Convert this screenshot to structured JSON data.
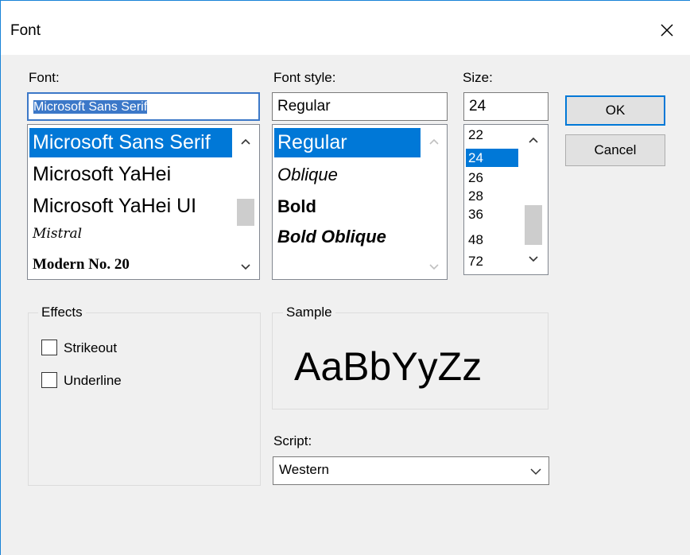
{
  "window": {
    "title": "Font"
  },
  "font": {
    "label": "Font:",
    "value": "Microsoft Sans Serif",
    "items": [
      "Microsoft Sans Serif",
      "Microsoft YaHei",
      "Microsoft YaHei UI",
      "Mistral",
      "Modern No. 20"
    ],
    "selected_index": 0
  },
  "style": {
    "label": "Font style:",
    "value": "Regular",
    "items": [
      "Regular",
      "Oblique",
      "Bold",
      "Bold Oblique"
    ],
    "selected_index": 0
  },
  "size": {
    "label": "Size:",
    "value": "24",
    "items": [
      "22",
      "24",
      "26",
      "28",
      "36",
      "48",
      "72"
    ],
    "selected_index": 1
  },
  "buttons": {
    "ok": "OK",
    "cancel": "Cancel"
  },
  "effects": {
    "label": "Effects",
    "strikeout": {
      "label": "Strikeout",
      "checked": false
    },
    "underline": {
      "label": "Underline",
      "checked": false
    }
  },
  "sample": {
    "label": "Sample",
    "text": "AaBbYyZz"
  },
  "script": {
    "label": "Script:",
    "value": "Western"
  },
  "icons": {
    "close": "close-icon",
    "scroll_up": "chevron-up-icon",
    "scroll_down": "chevron-down-icon",
    "dropdown": "chevron-down-icon"
  },
  "colors": {
    "selection": "#0078d7",
    "focus_border": "#3c78c8",
    "frame": "#1883d7"
  }
}
